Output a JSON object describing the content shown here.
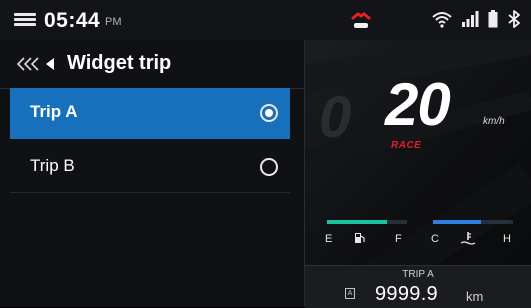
{
  "statusbar": {
    "time": "05:44",
    "ampm": "PM",
    "icons": [
      "menu-icon",
      "rider-alert-icon",
      "wifi-icon",
      "signal-icon",
      "battery-icon",
      "bluetooth-icon"
    ],
    "alert_color": "#e0202a"
  },
  "widget": {
    "title": "Widget trip",
    "back_icon": "triple-chevron-left-icon",
    "items": [
      {
        "label": "Trip A",
        "selected": true
      },
      {
        "label": "Trip B",
        "selected": false
      }
    ],
    "accent": "#1770bc"
  },
  "dashboard": {
    "ghost_digit": "0",
    "speed": "20",
    "unit": "km/h",
    "mode": "RACE",
    "fuel": {
      "empty_label": "E",
      "full_label": "F",
      "icon": "fuel-pump-icon",
      "level": 0.75,
      "color": "#19c3a0"
    },
    "temp": {
      "cold_label": "C",
      "hot_label": "H",
      "icon": "coolant-temp-icon",
      "level": 0.6,
      "color": "#2f7fe0"
    },
    "trip": {
      "label": "TRIP A",
      "value": "9999.9",
      "unit": "km"
    }
  }
}
